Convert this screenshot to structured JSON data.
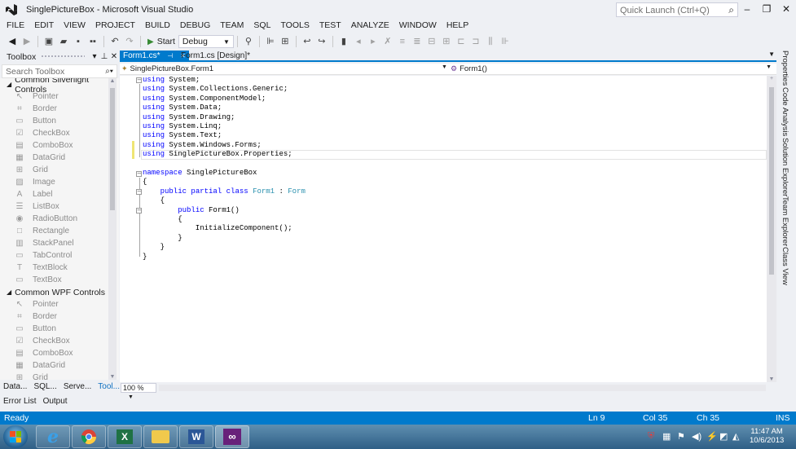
{
  "window": {
    "title": "SinglePictureBox - Microsoft Visual Studio",
    "quick_launch_placeholder": "Quick Launch (Ctrl+Q)"
  },
  "menu": [
    "FILE",
    "EDIT",
    "VIEW",
    "PROJECT",
    "BUILD",
    "DEBUG",
    "TEAM",
    "SQL",
    "TOOLS",
    "TEST",
    "ANALYZE",
    "WINDOW",
    "HELP"
  ],
  "toolbar": {
    "start_label": "Start",
    "config_value": "Debug"
  },
  "toolbox": {
    "title": "Toolbox",
    "search_placeholder": "Search Toolbox",
    "groups": [
      {
        "name": "Common Silverlight Controls",
        "items": [
          {
            "label": "Pointer",
            "icon": "pointer-icon"
          },
          {
            "label": "Border",
            "icon": "border-icon"
          },
          {
            "label": "Button",
            "icon": "button-icon"
          },
          {
            "label": "CheckBox",
            "icon": "checkbox-icon"
          },
          {
            "label": "ComboBox",
            "icon": "combobox-icon"
          },
          {
            "label": "DataGrid",
            "icon": "datagrid-icon"
          },
          {
            "label": "Grid",
            "icon": "grid-icon"
          },
          {
            "label": "Image",
            "icon": "image-icon"
          },
          {
            "label": "Label",
            "icon": "label-icon"
          },
          {
            "label": "ListBox",
            "icon": "listbox-icon"
          },
          {
            "label": "RadioButton",
            "icon": "radiobutton-icon"
          },
          {
            "label": "Rectangle",
            "icon": "rectangle-icon"
          },
          {
            "label": "StackPanel",
            "icon": "stackpanel-icon"
          },
          {
            "label": "TabControl",
            "icon": "tabcontrol-icon"
          },
          {
            "label": "TextBlock",
            "icon": "textblock-icon"
          },
          {
            "label": "TextBox",
            "icon": "textbox-icon"
          }
        ]
      },
      {
        "name": "Common WPF Controls",
        "items": [
          {
            "label": "Pointer",
            "icon": "pointer-icon"
          },
          {
            "label": "Border",
            "icon": "border-icon"
          },
          {
            "label": "Button",
            "icon": "button-icon"
          },
          {
            "label": "CheckBox",
            "icon": "checkbox-icon"
          },
          {
            "label": "ComboBox",
            "icon": "combobox-icon"
          },
          {
            "label": "DataGrid",
            "icon": "datagrid-icon"
          },
          {
            "label": "Grid",
            "icon": "grid-icon"
          }
        ]
      }
    ],
    "bottom_tabs": [
      "Data...",
      "SQL...",
      "Serve...",
      "Tool..."
    ]
  },
  "doc_tabs": [
    {
      "label": "Form1.cs*",
      "active": true
    },
    {
      "label": "Form1.cs [Design]*",
      "active": false
    }
  ],
  "nav": {
    "class_selector": "SinglePictureBox.Form1",
    "member_selector": "Form1()"
  },
  "code_lines": [
    [
      {
        "t": "using",
        "c": "kw"
      },
      {
        "t": " System;",
        "c": "tx"
      }
    ],
    [
      {
        "t": "using",
        "c": "kw"
      },
      {
        "t": " System.Collections.Generic;",
        "c": "tx"
      }
    ],
    [
      {
        "t": "using",
        "c": "kw"
      },
      {
        "t": " System.ComponentModel;",
        "c": "tx"
      }
    ],
    [
      {
        "t": "using",
        "c": "kw"
      },
      {
        "t": " System.Data;",
        "c": "tx"
      }
    ],
    [
      {
        "t": "using",
        "c": "kw"
      },
      {
        "t": " System.Drawing;",
        "c": "tx"
      }
    ],
    [
      {
        "t": "using",
        "c": "kw"
      },
      {
        "t": " System.Linq;",
        "c": "tx"
      }
    ],
    [
      {
        "t": "using",
        "c": "kw"
      },
      {
        "t": " System.Text;",
        "c": "tx"
      }
    ],
    [
      {
        "t": "using",
        "c": "kw"
      },
      {
        "t": " System.Windows.Forms;",
        "c": "tx"
      }
    ],
    [
      {
        "t": "using",
        "c": "kw"
      },
      {
        "t": " SinglePictureBox.Properties;",
        "c": "tx"
      }
    ],
    [],
    [
      {
        "t": "namespace",
        "c": "kw"
      },
      {
        "t": " SinglePictureBox",
        "c": "tx"
      }
    ],
    [
      {
        "t": "{",
        "c": "tx"
      }
    ],
    [
      {
        "t": "    ",
        "c": "tx"
      },
      {
        "t": "public",
        "c": "kw"
      },
      {
        "t": " ",
        "c": "tx"
      },
      {
        "t": "partial",
        "c": "kw"
      },
      {
        "t": " ",
        "c": "tx"
      },
      {
        "t": "class",
        "c": "kw"
      },
      {
        "t": " ",
        "c": "tx"
      },
      {
        "t": "Form1",
        "c": "ty"
      },
      {
        "t": " : ",
        "c": "tx"
      },
      {
        "t": "Form",
        "c": "ty"
      }
    ],
    [
      {
        "t": "    {",
        "c": "tx"
      }
    ],
    [
      {
        "t": "        ",
        "c": "tx"
      },
      {
        "t": "public",
        "c": "kw"
      },
      {
        "t": " Form1()",
        "c": "tx"
      }
    ],
    [
      {
        "t": "        {",
        "c": "tx"
      }
    ],
    [
      {
        "t": "            InitializeComponent();",
        "c": "tx"
      }
    ],
    [
      {
        "t": "        }",
        "c": "tx"
      }
    ],
    [
      {
        "t": "    }",
        "c": "tx"
      }
    ],
    [
      {
        "t": "}",
        "c": "tx"
      }
    ]
  ],
  "zoom": "100 %",
  "side_tabs": [
    "Properties",
    "Code Analysis",
    "Solution Explorer",
    "Team Explorer",
    "Class View"
  ],
  "output_tabs": [
    "Error List",
    "Output"
  ],
  "status": {
    "text": "Ready",
    "ln": "Ln 9",
    "col": "Col 35",
    "ch": "Ch 35",
    "mode": "INS"
  },
  "clock": {
    "time": "11:47 AM",
    "date": "10/6/2013"
  },
  "colors": {
    "accent": "#007acc",
    "keyword": "#0000ff",
    "type": "#2b91af",
    "modified_marker": "#efe574"
  }
}
